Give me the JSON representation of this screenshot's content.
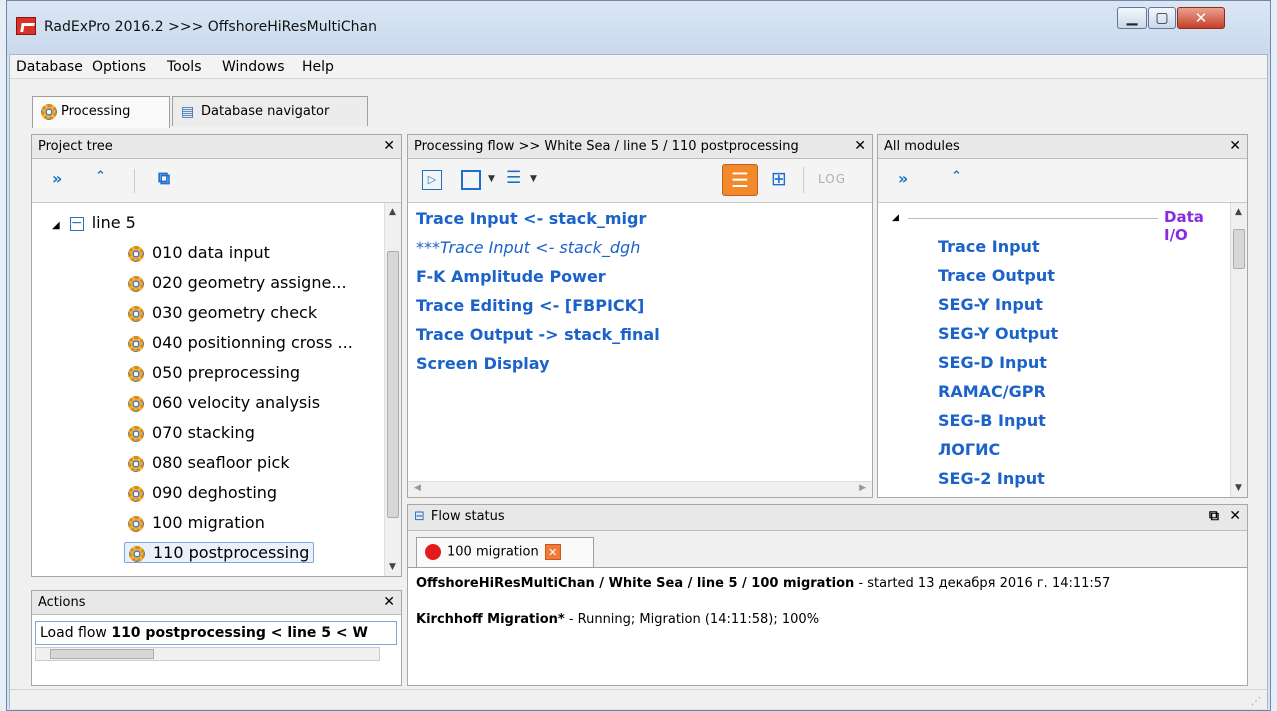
{
  "window": {
    "title": "RadExPro 2016.2 >>> OffshoreHiResMultiChan"
  },
  "menu": [
    "Database",
    "Options",
    "Tools",
    "Windows",
    "Help"
  ],
  "tabs": [
    {
      "label": "Processing",
      "icon": "gear-icon"
    },
    {
      "label": "Database navigator",
      "icon": "database-navigator-icon"
    }
  ],
  "project_tree": {
    "title": "Project tree",
    "node": "line 5",
    "items": [
      "010 data input",
      "020 geometry assigne...",
      "030 geometry check",
      "040 positionning cross ...",
      "050 preprocessing",
      "060 velocity analysis",
      "070 stacking",
      "080 seafloor pick",
      "090 deghosting",
      "100 migration",
      "110 postprocessing"
    ]
  },
  "actions": {
    "title": "Actions",
    "text_prefix": "Load flow ",
    "text_bold": "110 postprocessing < line 5 < W"
  },
  "processing_flow": {
    "title": "Processing flow >> White Sea / line 5 / 110 postprocessing",
    "items": [
      {
        "label": "Trace Input <- stack_migr",
        "italic": false
      },
      {
        "label": "***Trace Input <- stack_dgh",
        "italic": true
      },
      {
        "label": "F-K Amplitude Power",
        "italic": false
      },
      {
        "label": "Trace Editing <- [FBPICK]",
        "italic": false
      },
      {
        "label": "Trace Output -> stack_final",
        "italic": false
      },
      {
        "label": "Screen Display",
        "italic": false
      }
    ],
    "toolbar_log": "LOG"
  },
  "all_modules": {
    "title": "All modules",
    "group": "Data I/O",
    "items": [
      "Trace Input",
      "Trace Output",
      "SEG-Y Input",
      "SEG-Y Output",
      "SEG-D Input",
      "RAMAC/GPR",
      "SEG-B Input",
      "ЛОГИС",
      "SEG-2 Input"
    ]
  },
  "flow_status": {
    "title": "Flow status",
    "tab_label": "100 migration",
    "line1_bold": "OffshoreHiResMultiChan / White Sea / line 5 / 100 migration",
    "line1_rest": "  -  started 13 декабря 2016 г. 14:11:57",
    "line2_bold": "Kirchhoff Migration*",
    "line2_rest": " - Running; Migration (14:11:58); 100%"
  },
  "colors": {
    "accent": "#1b62c9",
    "group_title": "#8a2be2",
    "status_dot": "#e21b1b"
  }
}
